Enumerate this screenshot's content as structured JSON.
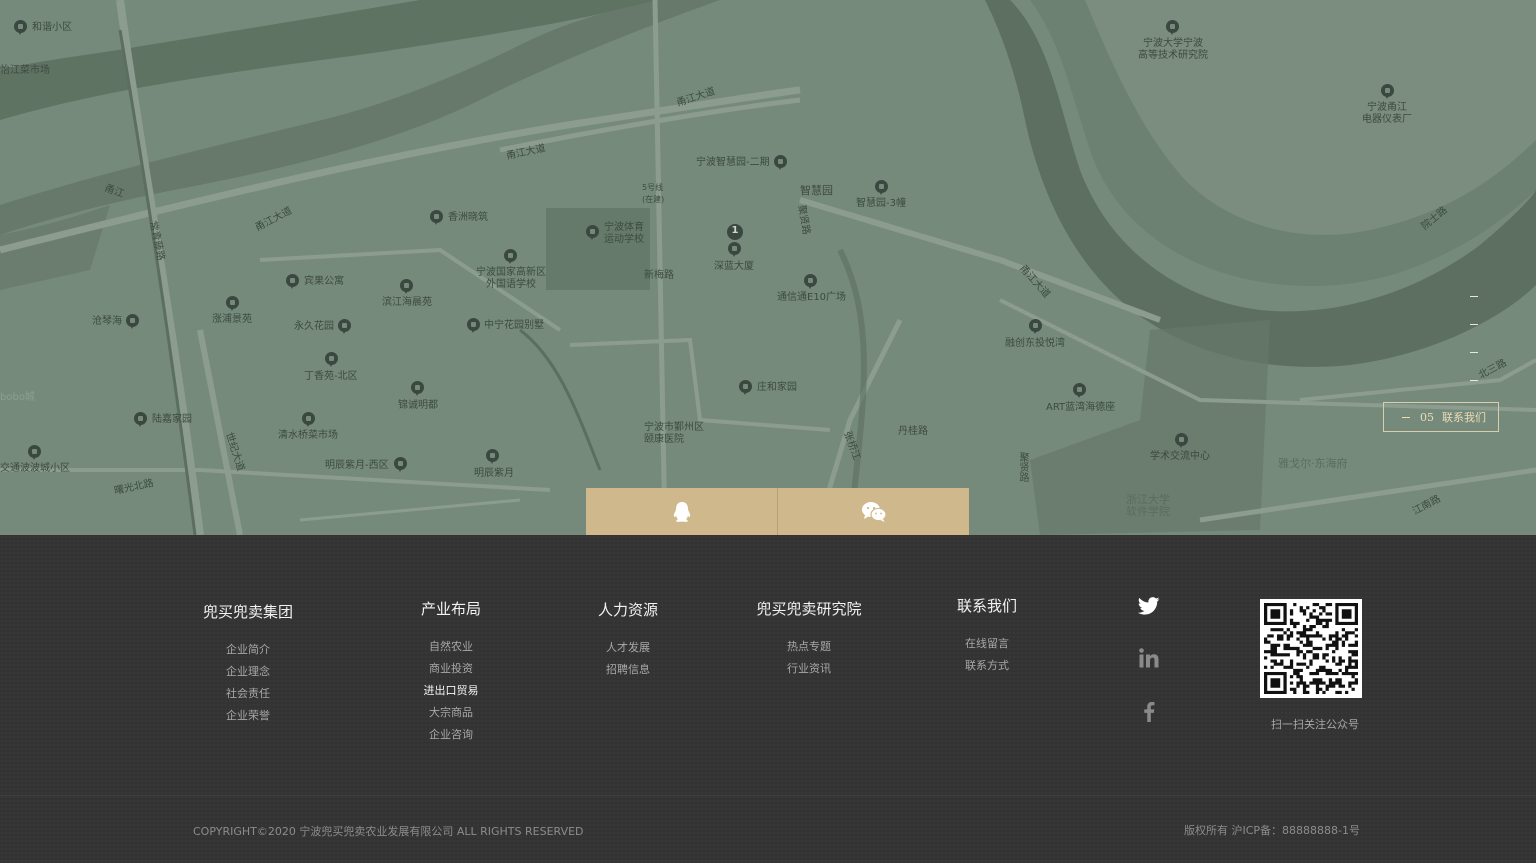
{
  "map": {
    "marker_number": "1",
    "labels": [
      {
        "text": "和谐小区"
      },
      {
        "text": "怡江菜市场"
      },
      {
        "text": "宁波大学宁波\n高等技术研究院"
      },
      {
        "text": "宁波甬江\n电器仪表厂"
      },
      {
        "text": "甬江大道"
      },
      {
        "text": "甬江大道"
      },
      {
        "text": "甬江大道"
      },
      {
        "text": "甬江大道"
      },
      {
        "text": "宁波智慧园-二期"
      },
      {
        "text": "智慧园"
      },
      {
        "text": "智慧园-3幢"
      },
      {
        "text": "5号线\n(在建)"
      },
      {
        "text": "宁波体育\n运动学校"
      },
      {
        "text": "香洲晓筑"
      },
      {
        "text": "宁波国家高新区\n外国语学校"
      },
      {
        "text": "深蓝大厦"
      },
      {
        "text": "通信通E10广场"
      },
      {
        "text": "宾果公寓"
      },
      {
        "text": "滨江海晨苑"
      },
      {
        "text": "涨浦景苑"
      },
      {
        "text": "永久花园"
      },
      {
        "text": "中宁花园别墅"
      },
      {
        "text": "沧琴海"
      },
      {
        "text": "丁香苑-北区"
      },
      {
        "text": "锦诚明都"
      },
      {
        "text": "庄和家园"
      },
      {
        "text": "融创东投悦湾"
      },
      {
        "text": "ART蓝湾海德座"
      },
      {
        "text": "陆嘉家园"
      },
      {
        "text": "清水桥菜市场"
      },
      {
        "text": "宁波市鄞州区\n颐康医院"
      },
      {
        "text": "丹桂路"
      },
      {
        "text": "聚贤路"
      },
      {
        "text": "明辰紫月-西区"
      },
      {
        "text": "明辰紫月"
      },
      {
        "text": "学术交流中心"
      },
      {
        "text": "雅戈尔·东海府"
      },
      {
        "text": "浙江大学\n软件学院"
      },
      {
        "text": "江南路"
      },
      {
        "text": "北三路"
      },
      {
        "text": "交通波波城小区"
      },
      {
        "text": "曙光北路"
      },
      {
        "text": "世纪大道"
      },
      {
        "text": "常青藤路"
      },
      {
        "text": "聚贤路"
      },
      {
        "text": "新梅路"
      },
      {
        "text": "院士路"
      },
      {
        "text": "张桥江"
      },
      {
        "text": "bobo城"
      },
      {
        "text": "甬江"
      }
    ]
  },
  "side_nav": {
    "current_number": "05",
    "current_label": "联系我们"
  },
  "contact_tabs": [
    {
      "icon": "qq-icon"
    },
    {
      "icon": "wechat-icon"
    }
  ],
  "footer": {
    "columns": [
      {
        "title": "兜买兜卖集团",
        "items": [
          "企业简介",
          "企业理念",
          "社会责任",
          "企业荣誉"
        ]
      },
      {
        "title": "产业布局",
        "items": [
          "自然农业",
          "商业投资",
          "进出口贸易",
          "大宗商品",
          "企业咨询"
        ],
        "active_index": 2
      },
      {
        "title": "人力资源",
        "items": [
          "人才发展",
          "招聘信息"
        ]
      },
      {
        "title": "兜买兜卖研究院",
        "items": [
          "热点专题",
          "行业资讯"
        ]
      },
      {
        "title": "联系我们",
        "items": [
          "在线留言",
          "联系方式"
        ]
      }
    ],
    "social": [
      "twitter-icon",
      "linkedin-icon",
      "facebook-icon"
    ],
    "qr_caption": "扫一扫关注公众号",
    "copyright": "COPYRIGHT©2020 宁波兜买兜卖农业发展有限公司 ALL RIGHTS RESERVED",
    "icp": "版权所有 沪ICP备：88888888-1号"
  },
  "colors": {
    "map_bg": "#768a7b",
    "river": "#5f7363",
    "road": "#8c9d90",
    "tab_bg": "#cfb98c",
    "footer_bg": "#333333"
  }
}
